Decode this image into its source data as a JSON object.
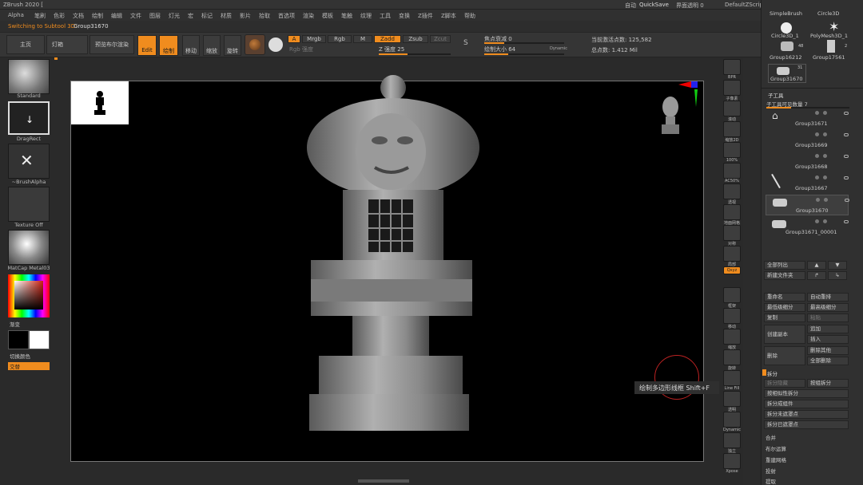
{
  "app": {
    "title": "ZBrush 2020 [",
    "auto_label": "自动",
    "quicksave": "QuickSave",
    "interface_transparency": "界面透明 0",
    "default_script": "DefaultZScript"
  },
  "menu": [
    "Alpha",
    "笔刷",
    "色彩",
    "文档",
    "绘制",
    "编辑",
    "文件",
    "图层",
    "灯光",
    "宏",
    "标记",
    "材质",
    "影片",
    "拾取",
    "首选项",
    "渲染",
    "模板",
    "笔触",
    "纹理",
    "工具",
    "变换",
    "Z插件",
    "Z脚本",
    "帮助"
  ],
  "info": {
    "switching": "Switching to Subtool 3D:",
    "subtool": "Group31670"
  },
  "toolbar": {
    "home": "主页",
    "lightbox": "灯箱",
    "preview_render": "预览布尔渲染",
    "edit": "Edit",
    "draw": "绘制",
    "move": "移动",
    "scale": "缩放",
    "rotate": "旋转",
    "a_btn": "A",
    "mrgb": "Mrgb",
    "rgb": "Rgb",
    "m": "M",
    "zadd": "Zadd",
    "zsub": "Zsub",
    "zcut": "Zcut",
    "rgb_intensity": "Rgb 强度",
    "z_intensity": "Z 强度 25",
    "focal_shift": "焦点衰减 0",
    "draw_size": "绘制大小 64",
    "dynamic": "Dynamic",
    "active_points": "当前激活点数: 125,582",
    "total_points": "总点数: 1.412 Mil",
    "s_label": "S"
  },
  "left_shelf": {
    "brush": "Standard",
    "stroke": "DragRect",
    "alpha": "~BrushAlpha",
    "texture": "Texture Off",
    "material": "MatCap Metal03",
    "gradient": "渐变",
    "switch_color": "切换颜色",
    "alternate": "交替"
  },
  "right_shelf": [
    "BPR",
    "子像素",
    "滚动",
    "缩放2D",
    "100%",
    "AC50%",
    "透视",
    "地面网格",
    "对称",
    "局部",
    "Qxyz",
    "框架",
    "移动",
    "缩放",
    "旋转",
    "Line Fill",
    "透明",
    "Dynamic",
    "独立",
    "Xpose"
  ],
  "tooltip": "绘制多边形线框  Shift+F",
  "panel": {
    "brushes": [
      "SimpleBrush",
      "Circle3D",
      "Circle3D_1",
      "PolyMesh3D_1",
      "Group16212",
      "Group17561",
      "Group31670"
    ],
    "brush_counts": [
      "48",
      "2",
      "31"
    ],
    "subtool_header": "子工具",
    "visible_count": "子工具可见数量 7",
    "subtools": [
      "Group31671",
      "Group31669",
      "Group31668",
      "Group31667",
      "Group31670",
      "Group31671_00001"
    ],
    "buttons": {
      "list_all": "全部列出",
      "new_folder": "新建文件夹",
      "rename": "重命名",
      "auto_reorder": "自动重排",
      "lowest_res": "最低级细分",
      "highest_res": "最高级细分",
      "duplicate": "复制",
      "paste": "粘贴",
      "create_copy": "创建副本",
      "append": "追加",
      "insert": "插入",
      "delete": "删除",
      "delete_other": "删除其他",
      "delete_all": "全部删除",
      "split": "拆分",
      "split_hidden": "拆分隐藏",
      "groups_split": "按组拆分",
      "split_by_sim": "按相似性拆分",
      "split_to_parts": "拆分成组件",
      "split_unmasked": "拆分未遮罩点",
      "split_masked": "拆分已遮罩点",
      "merge": "合并",
      "boolean": "布尔运算",
      "remesh": "重建网格",
      "project": "投射",
      "extract": "提取"
    }
  },
  "colors": {
    "accent": "#f08c1e",
    "canvas": "#000000",
    "panel": "#303030"
  }
}
